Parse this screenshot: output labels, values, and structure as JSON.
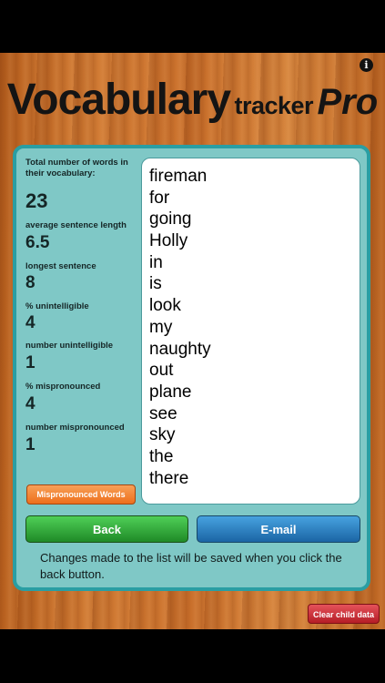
{
  "header": {
    "title_word1": "Vocabulary",
    "title_word2": "tracker",
    "title_word3": "Pro",
    "info_icon": "info-icon"
  },
  "stats": {
    "total_label": "Total number of words in their vocabulary:",
    "total_value": "23",
    "avg_label": "average sentence length",
    "avg_value": "6.5",
    "longest_label": "longest sentence",
    "longest_value": "8",
    "pct_unintelligible_label": "% unintelligible",
    "pct_unintelligible_value": "4",
    "num_unintelligible_label": "number unintelligible",
    "num_unintelligible_value": "1",
    "pct_mispronounced_label": "% mispronounced",
    "pct_mispronounced_value": "4",
    "num_mispronounced_label": "number mispronounced",
    "num_mispronounced_value": "1"
  },
  "words": [
    "fireman",
    "for",
    "going",
    "Holly",
    "in",
    "is",
    "look",
    "my",
    "naughty",
    "out",
    "plane",
    "see",
    "sky",
    "the",
    "there"
  ],
  "buttons": {
    "mispronounced": "Mispronounced Words",
    "back": "Back",
    "email": "E-mail",
    "clear": "Clear child data"
  },
  "note": "Changes made to the list will be saved when you click the back button.",
  "colors": {
    "panel": "#7fc8c6",
    "panel_border": "#2a9ea3",
    "back": "#2ea836",
    "email": "#2478bd",
    "mispronounced": "#f07d2a",
    "clear": "#c9303a"
  }
}
